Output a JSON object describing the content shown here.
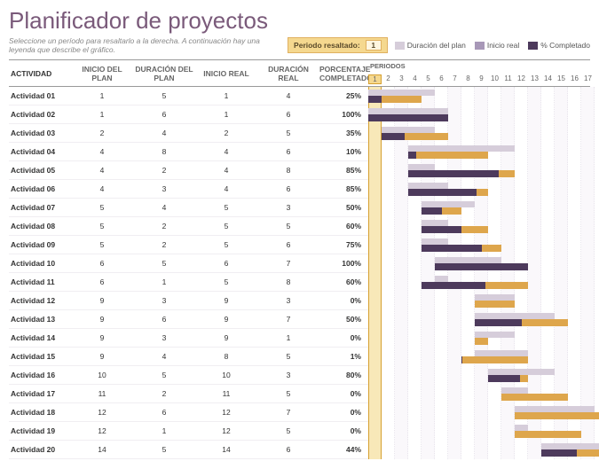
{
  "title": "Planificador de proyectos",
  "subtitle": "Seleccione un período para resaltarlo a la derecha.  A continuación hay una leyenda que describe el gráfico.",
  "highlight": {
    "label": "Periodo resaltado:",
    "value": "1"
  },
  "legend": {
    "plan": "Duración del plan",
    "real": "Inicio real",
    "pct": "% Completado"
  },
  "cols": {
    "name": "ACTIVIDAD",
    "planStart": "INICIO DEL PLAN",
    "planDur": "DURACIÓN DEL PLAN",
    "realStart": "INICIO REAL",
    "realDur": "DURACIÓN REAL",
    "pct": "PORCENTAJE COMPLETADO",
    "periods": "PERIODOS"
  },
  "periods": [
    "1",
    "2",
    "3",
    "4",
    "5",
    "6",
    "7",
    "8",
    "9",
    "10",
    "11",
    "12",
    "13",
    "14",
    "15",
    "16",
    "17"
  ],
  "chart_data": {
    "type": "bar",
    "title": "Planificador de proyectos",
    "xlabel": "PERIODOS",
    "ylabel": "ACTIVIDAD",
    "xlim": [
      1,
      17
    ],
    "highlight_period": 1,
    "series_names": [
      "Duración del plan",
      "Inicio real",
      "% Completado"
    ],
    "rows": [
      {
        "name": "Actividad 01",
        "planStart": 1,
        "planDur": 5,
        "realStart": 1,
        "realDur": 4,
        "pct": 25
      },
      {
        "name": "Actividad 02",
        "planStart": 1,
        "planDur": 6,
        "realStart": 1,
        "realDur": 6,
        "pct": 100
      },
      {
        "name": "Actividad 03",
        "planStart": 2,
        "planDur": 4,
        "realStart": 2,
        "realDur": 5,
        "pct": 35
      },
      {
        "name": "Actividad 04",
        "planStart": 4,
        "planDur": 8,
        "realStart": 4,
        "realDur": 6,
        "pct": 10
      },
      {
        "name": "Actividad 05",
        "planStart": 4,
        "planDur": 2,
        "realStart": 4,
        "realDur": 8,
        "pct": 85
      },
      {
        "name": "Actividad 06",
        "planStart": 4,
        "planDur": 3,
        "realStart": 4,
        "realDur": 6,
        "pct": 85
      },
      {
        "name": "Actividad 07",
        "planStart": 5,
        "planDur": 4,
        "realStart": 5,
        "realDur": 3,
        "pct": 50
      },
      {
        "name": "Actividad 08",
        "planStart": 5,
        "planDur": 2,
        "realStart": 5,
        "realDur": 5,
        "pct": 60
      },
      {
        "name": "Actividad 09",
        "planStart": 5,
        "planDur": 2,
        "realStart": 5,
        "realDur": 6,
        "pct": 75
      },
      {
        "name": "Actividad 10",
        "planStart": 6,
        "planDur": 5,
        "realStart": 6,
        "realDur": 7,
        "pct": 100
      },
      {
        "name": "Actividad 11",
        "planStart": 6,
        "planDur": 1,
        "realStart": 5,
        "realDur": 8,
        "pct": 60
      },
      {
        "name": "Actividad 12",
        "planStart": 9,
        "planDur": 3,
        "realStart": 9,
        "realDur": 3,
        "pct": 0
      },
      {
        "name": "Actividad 13",
        "planStart": 9,
        "planDur": 6,
        "realStart": 9,
        "realDur": 7,
        "pct": 50
      },
      {
        "name": "Actividad 14",
        "planStart": 9,
        "planDur": 3,
        "realStart": 9,
        "realDur": 1,
        "pct": 0
      },
      {
        "name": "Actividad 15",
        "planStart": 9,
        "planDur": 4,
        "realStart": 8,
        "realDur": 5,
        "pct": 1
      },
      {
        "name": "Actividad 16",
        "planStart": 10,
        "planDur": 5,
        "realStart": 10,
        "realDur": 3,
        "pct": 80
      },
      {
        "name": "Actividad 17",
        "planStart": 11,
        "planDur": 2,
        "realStart": 11,
        "realDur": 5,
        "pct": 0
      },
      {
        "name": "Actividad 18",
        "planStart": 12,
        "planDur": 6,
        "realStart": 12,
        "realDur": 7,
        "pct": 0
      },
      {
        "name": "Actividad 19",
        "planStart": 12,
        "planDur": 1,
        "realStart": 12,
        "realDur": 5,
        "pct": 0
      },
      {
        "name": "Actividad 20",
        "planStart": 14,
        "planDur": 5,
        "realStart": 14,
        "realDur": 6,
        "pct": 44
      }
    ]
  }
}
